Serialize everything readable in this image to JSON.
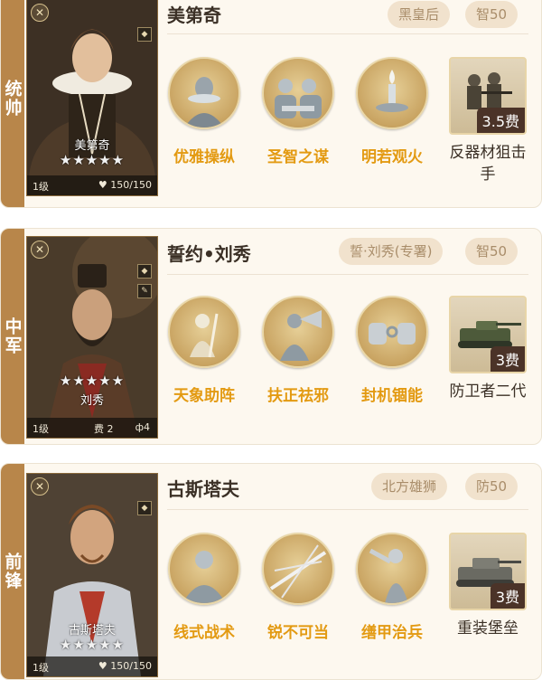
{
  "cards": [
    {
      "role": "统帅",
      "name": "美第奇",
      "portrait_name": "美第奇",
      "stars": "★★★★★",
      "level": "1级",
      "hp": "150/150",
      "tags": [
        "黑皇后",
        "智50"
      ],
      "skills": [
        {
          "label": "优雅操纵",
          "icon": "lady-bust-icon"
        },
        {
          "label": "圣智之谋",
          "icon": "council-figures-icon"
        },
        {
          "label": "明若观火",
          "icon": "candle-icon"
        }
      ],
      "unit": {
        "cost": "3.5费",
        "label": "反器材狙击手",
        "icon": "sniper-soldiers-icon"
      }
    },
    {
      "role": "中军",
      "name": "誓约•刘秀",
      "portrait_name": "刘秀",
      "stars": "★★★★★",
      "level": "1级",
      "cost_text": "费 2",
      "sig_text": "ф4",
      "tags": [
        "誓·刘秀(专署)",
        "智50"
      ],
      "skills": [
        {
          "label": "天象助阵",
          "icon": "sage-with-staff-icon"
        },
        {
          "label": "扶正祛邪",
          "icon": "horn-blower-icon"
        },
        {
          "label": "封机锢能",
          "icon": "chained-fists-icon"
        }
      ],
      "unit": {
        "cost": "3费",
        "label": "防卫者二代",
        "icon": "tank-icon"
      }
    },
    {
      "role": "前锋",
      "name": "古斯塔夫",
      "portrait_name": "古斯塔夫",
      "stars": "★★★★★",
      "level": "1级",
      "hp": "150/150",
      "tags": [
        "北方雄狮",
        "防50"
      ],
      "skills": [
        {
          "label": "线式战术",
          "icon": "commander-bust-icon"
        },
        {
          "label": "锐不可当",
          "icon": "spear-burst-icon"
        },
        {
          "label": "缮甲治兵",
          "icon": "pointing-statue-icon"
        }
      ],
      "unit": {
        "cost": "3费",
        "label": "重装堡垒",
        "icon": "heavy-tank-icon"
      }
    }
  ]
}
